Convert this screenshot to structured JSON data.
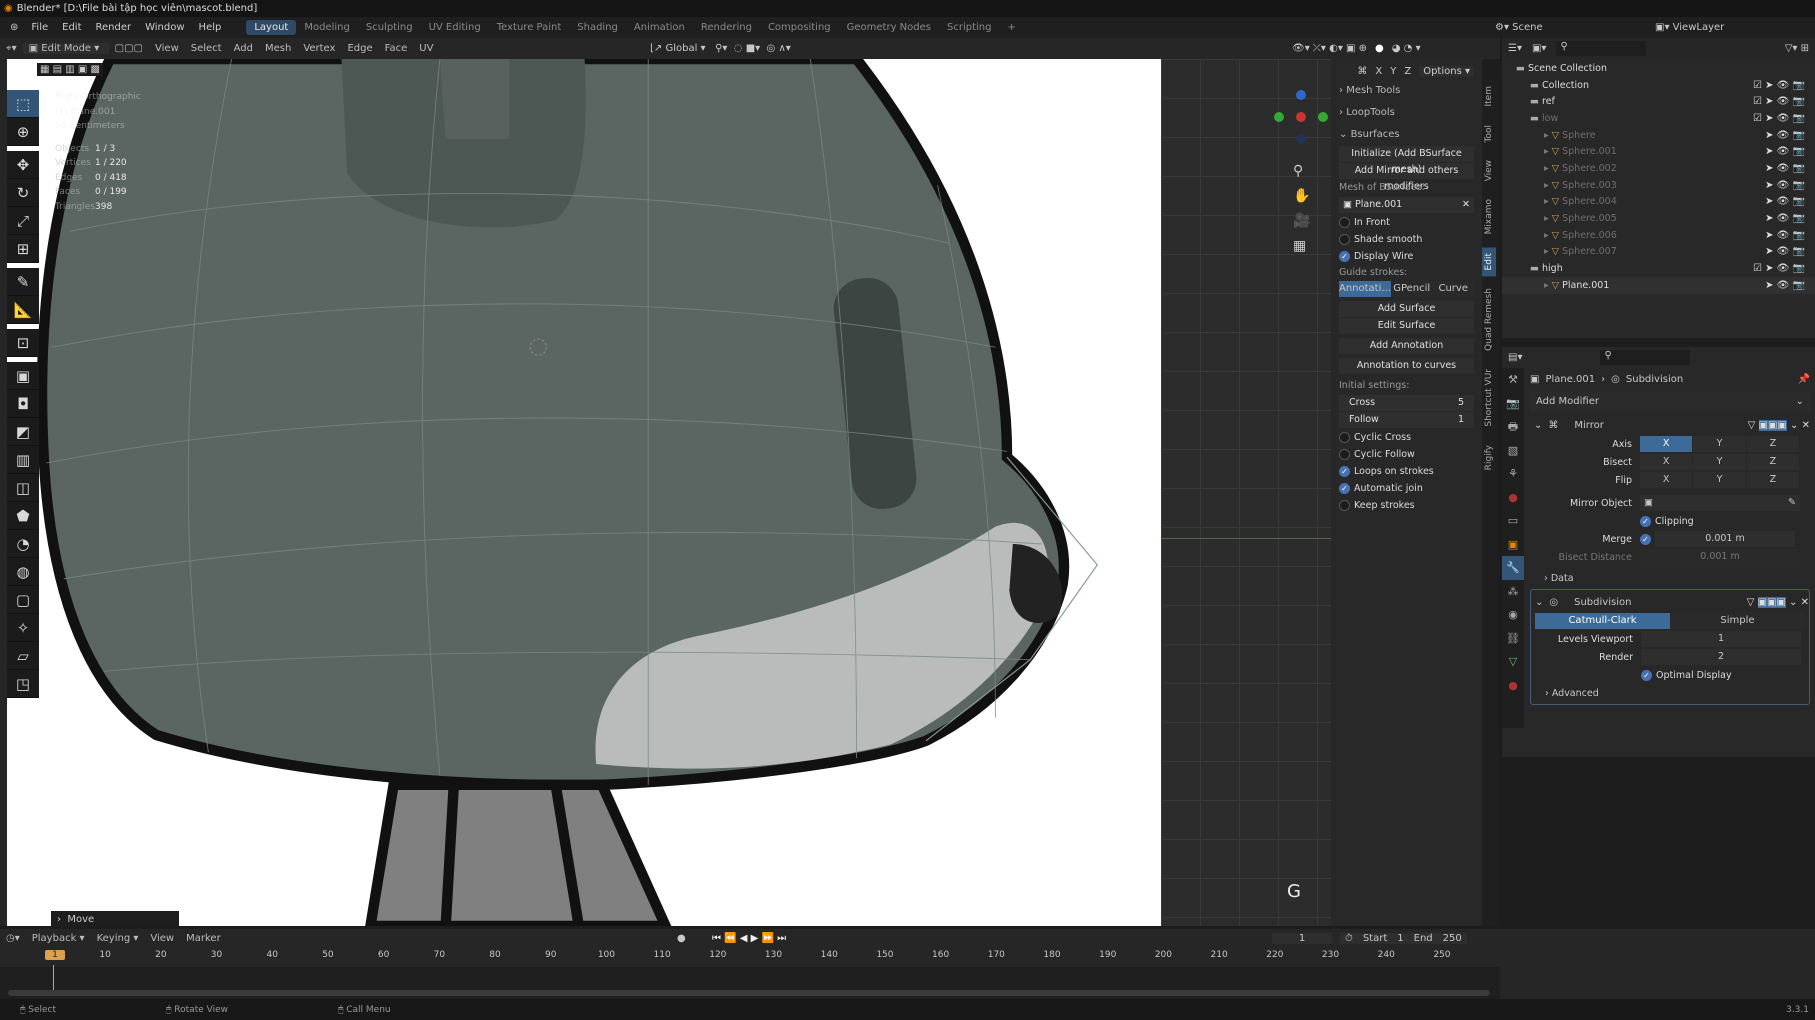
{
  "window": {
    "title": "Blender* [D:\\File bài tập học viên\\mascot.blend]"
  },
  "menu": [
    "File",
    "Edit",
    "Render",
    "Window",
    "Help"
  ],
  "workspaces": [
    {
      "label": "Layout",
      "active": true
    },
    {
      "label": "Modeling"
    },
    {
      "label": "Sculpting"
    },
    {
      "label": "UV Editing"
    },
    {
      "label": "Texture Paint"
    },
    {
      "label": "Shading"
    },
    {
      "label": "Animation"
    },
    {
      "label": "Rendering"
    },
    {
      "label": "Compositing"
    },
    {
      "label": "Geometry Nodes"
    },
    {
      "label": "Scripting"
    },
    {
      "label": "+"
    }
  ],
  "scene": {
    "label": "Scene",
    "view_layer": "ViewLayer"
  },
  "header": {
    "mode": "Edit Mode",
    "menus": [
      "View",
      "Select",
      "Add",
      "Mesh",
      "Vertex",
      "Edge",
      "Face",
      "UV"
    ],
    "orientation": "Global",
    "axes": [
      "X",
      "Y",
      "Z"
    ],
    "options": "Options"
  },
  "viewport": {
    "overlay_lines": [
      "Right Orthographic",
      "(1) Plane.001",
      "10 Centimeters"
    ],
    "stats": [
      {
        "label": "Objects",
        "value": "1 / 3"
      },
      {
        "label": "Vertices",
        "value": "1 / 220"
      },
      {
        "label": "Edges",
        "value": "0 / 418"
      },
      {
        "label": "Faces",
        "value": "0 / 199"
      },
      {
        "label": "Triangles",
        "value": "398"
      }
    ],
    "operator_panel": "Move",
    "key_hint": "G"
  },
  "npanel": {
    "sections": [
      "Mesh Tools",
      "LoopTools",
      "Bsurfaces"
    ],
    "buttons_top": [
      "Initialize (Add BSurface mesh)",
      "Add Mirror and others modifiers"
    ],
    "mesh_label": "Mesh of BSurface:",
    "mesh_value": "Plane.001",
    "checks1": [
      {
        "label": "In Front",
        "on": false
      },
      {
        "label": "Shade smooth",
        "on": false
      },
      {
        "label": "Display Wire",
        "on": true
      }
    ],
    "guide_label": "Guide strokes:",
    "guide_tabs": [
      "Annotati...",
      "GPencil",
      "Curve"
    ],
    "buttons_mid": [
      "Add Surface",
      "Edit Surface",
      "Add Annotation",
      "Annotation to curves"
    ],
    "initial_label": "Initial settings:",
    "cross_label": "Cross",
    "cross": "5",
    "follow_label": "Follow",
    "follow": "1",
    "checks2": [
      {
        "label": "Cyclic Cross",
        "on": false
      },
      {
        "label": "Cyclic Follow",
        "on": false
      },
      {
        "label": "Loops on strokes",
        "on": true
      },
      {
        "label": "Automatic join",
        "on": true
      },
      {
        "label": "Keep strokes",
        "on": false
      }
    ],
    "tabs": [
      "Item",
      "Tool",
      "View",
      "Mixamo",
      "Edit",
      "Quad Remesh",
      "Shortcut VUr",
      "Rigify"
    ],
    "active_tab": "Edit"
  },
  "outliner": {
    "rows": [
      {
        "name": "Scene Collection",
        "indent": 0,
        "type": "collection"
      },
      {
        "name": "Collection",
        "indent": 1,
        "type": "collection"
      },
      {
        "name": "ref",
        "indent": 1,
        "type": "collection"
      },
      {
        "name": "low",
        "indent": 1,
        "type": "collection",
        "dim": true
      },
      {
        "name": "Sphere",
        "indent": 2,
        "type": "mesh",
        "dim": true
      },
      {
        "name": "Sphere.001",
        "indent": 2,
        "type": "mesh",
        "dim": true
      },
      {
        "name": "Sphere.002",
        "indent": 2,
        "type": "mesh",
        "dim": true
      },
      {
        "name": "Sphere.003",
        "indent": 2,
        "type": "mesh",
        "dim": true
      },
      {
        "name": "Sphere.004",
        "indent": 2,
        "type": "mesh",
        "dim": true
      },
      {
        "name": "Sphere.005",
        "indent": 2,
        "type": "mesh",
        "dim": true
      },
      {
        "name": "Sphere.006",
        "indent": 2,
        "type": "mesh",
        "dim": true
      },
      {
        "name": "Sphere.007",
        "indent": 2,
        "type": "mesh",
        "dim": true
      },
      {
        "name": "high",
        "indent": 1,
        "type": "collection"
      },
      {
        "name": "Plane.001",
        "indent": 2,
        "type": "mesh"
      }
    ]
  },
  "properties": {
    "breadcrumb": [
      "Plane.001",
      "Subdivision"
    ],
    "add_modifier": "Add Modifier",
    "mirror": {
      "name": "Mirror",
      "axis_label": "Axis",
      "bisect_label": "Bisect",
      "flip_label": "Flip",
      "axes": [
        "X",
        "Y",
        "Z"
      ],
      "mirror_object_label": "Mirror Object",
      "clipping": "Clipping",
      "merge_label": "Merge",
      "merge": "0.001 m",
      "bisect_distance_label": "Bisect Distance",
      "bisect_distance": "0.001 m",
      "data": "Data"
    },
    "subdivision": {
      "name": "Subdivision",
      "types": [
        "Catmull-Clark",
        "Simple"
      ],
      "levels_label": "Levels Viewport",
      "levels": "1",
      "render_label": "Render",
      "render": "2",
      "optimal": "Optimal Display",
      "advanced": "Advanced"
    }
  },
  "timeline": {
    "menus": [
      "Playback",
      "Keying",
      "View",
      "Marker"
    ],
    "current_frame": "1",
    "start_label": "Start",
    "start": "1",
    "end_label": "End",
    "end": "250",
    "ticks": [
      "1",
      "10",
      "20",
      "30",
      "40",
      "50",
      "60",
      "70",
      "80",
      "90",
      "100",
      "110",
      "120",
      "130",
      "140",
      "150",
      "160",
      "170",
      "180",
      "190",
      "200",
      "210",
      "220",
      "230",
      "240",
      "250"
    ]
  },
  "status": {
    "items": [
      "Select",
      "Rotate View",
      "Call Menu"
    ],
    "version": "3.3.1"
  },
  "colors": {
    "accent": "#4772b3",
    "active_tab": "#335577",
    "mesh_body": "#5b6662"
  }
}
